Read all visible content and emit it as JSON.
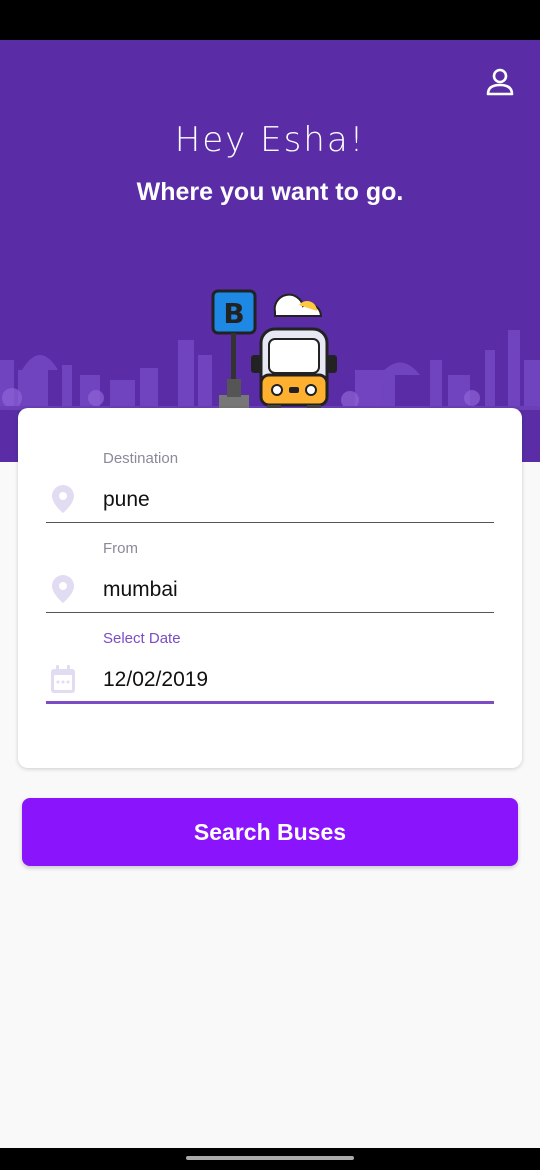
{
  "header": {
    "greeting": "Hey Esha!",
    "subtitle": "Where you want to go.",
    "profile_icon": "person-icon"
  },
  "form": {
    "destination": {
      "label": "Destination",
      "value": "pune",
      "icon": "location-pin-icon"
    },
    "from": {
      "label": "From",
      "value": "mumbai",
      "icon": "location-pin-icon"
    },
    "date": {
      "label": "Select Date",
      "value": "12/02/2019",
      "icon": "calendar-icon"
    }
  },
  "search_button": {
    "label": "Search Buses"
  },
  "colors": {
    "hero_bg": "#5a2da7",
    "accent": "#7b4cc4",
    "button": "#8a15fc"
  }
}
